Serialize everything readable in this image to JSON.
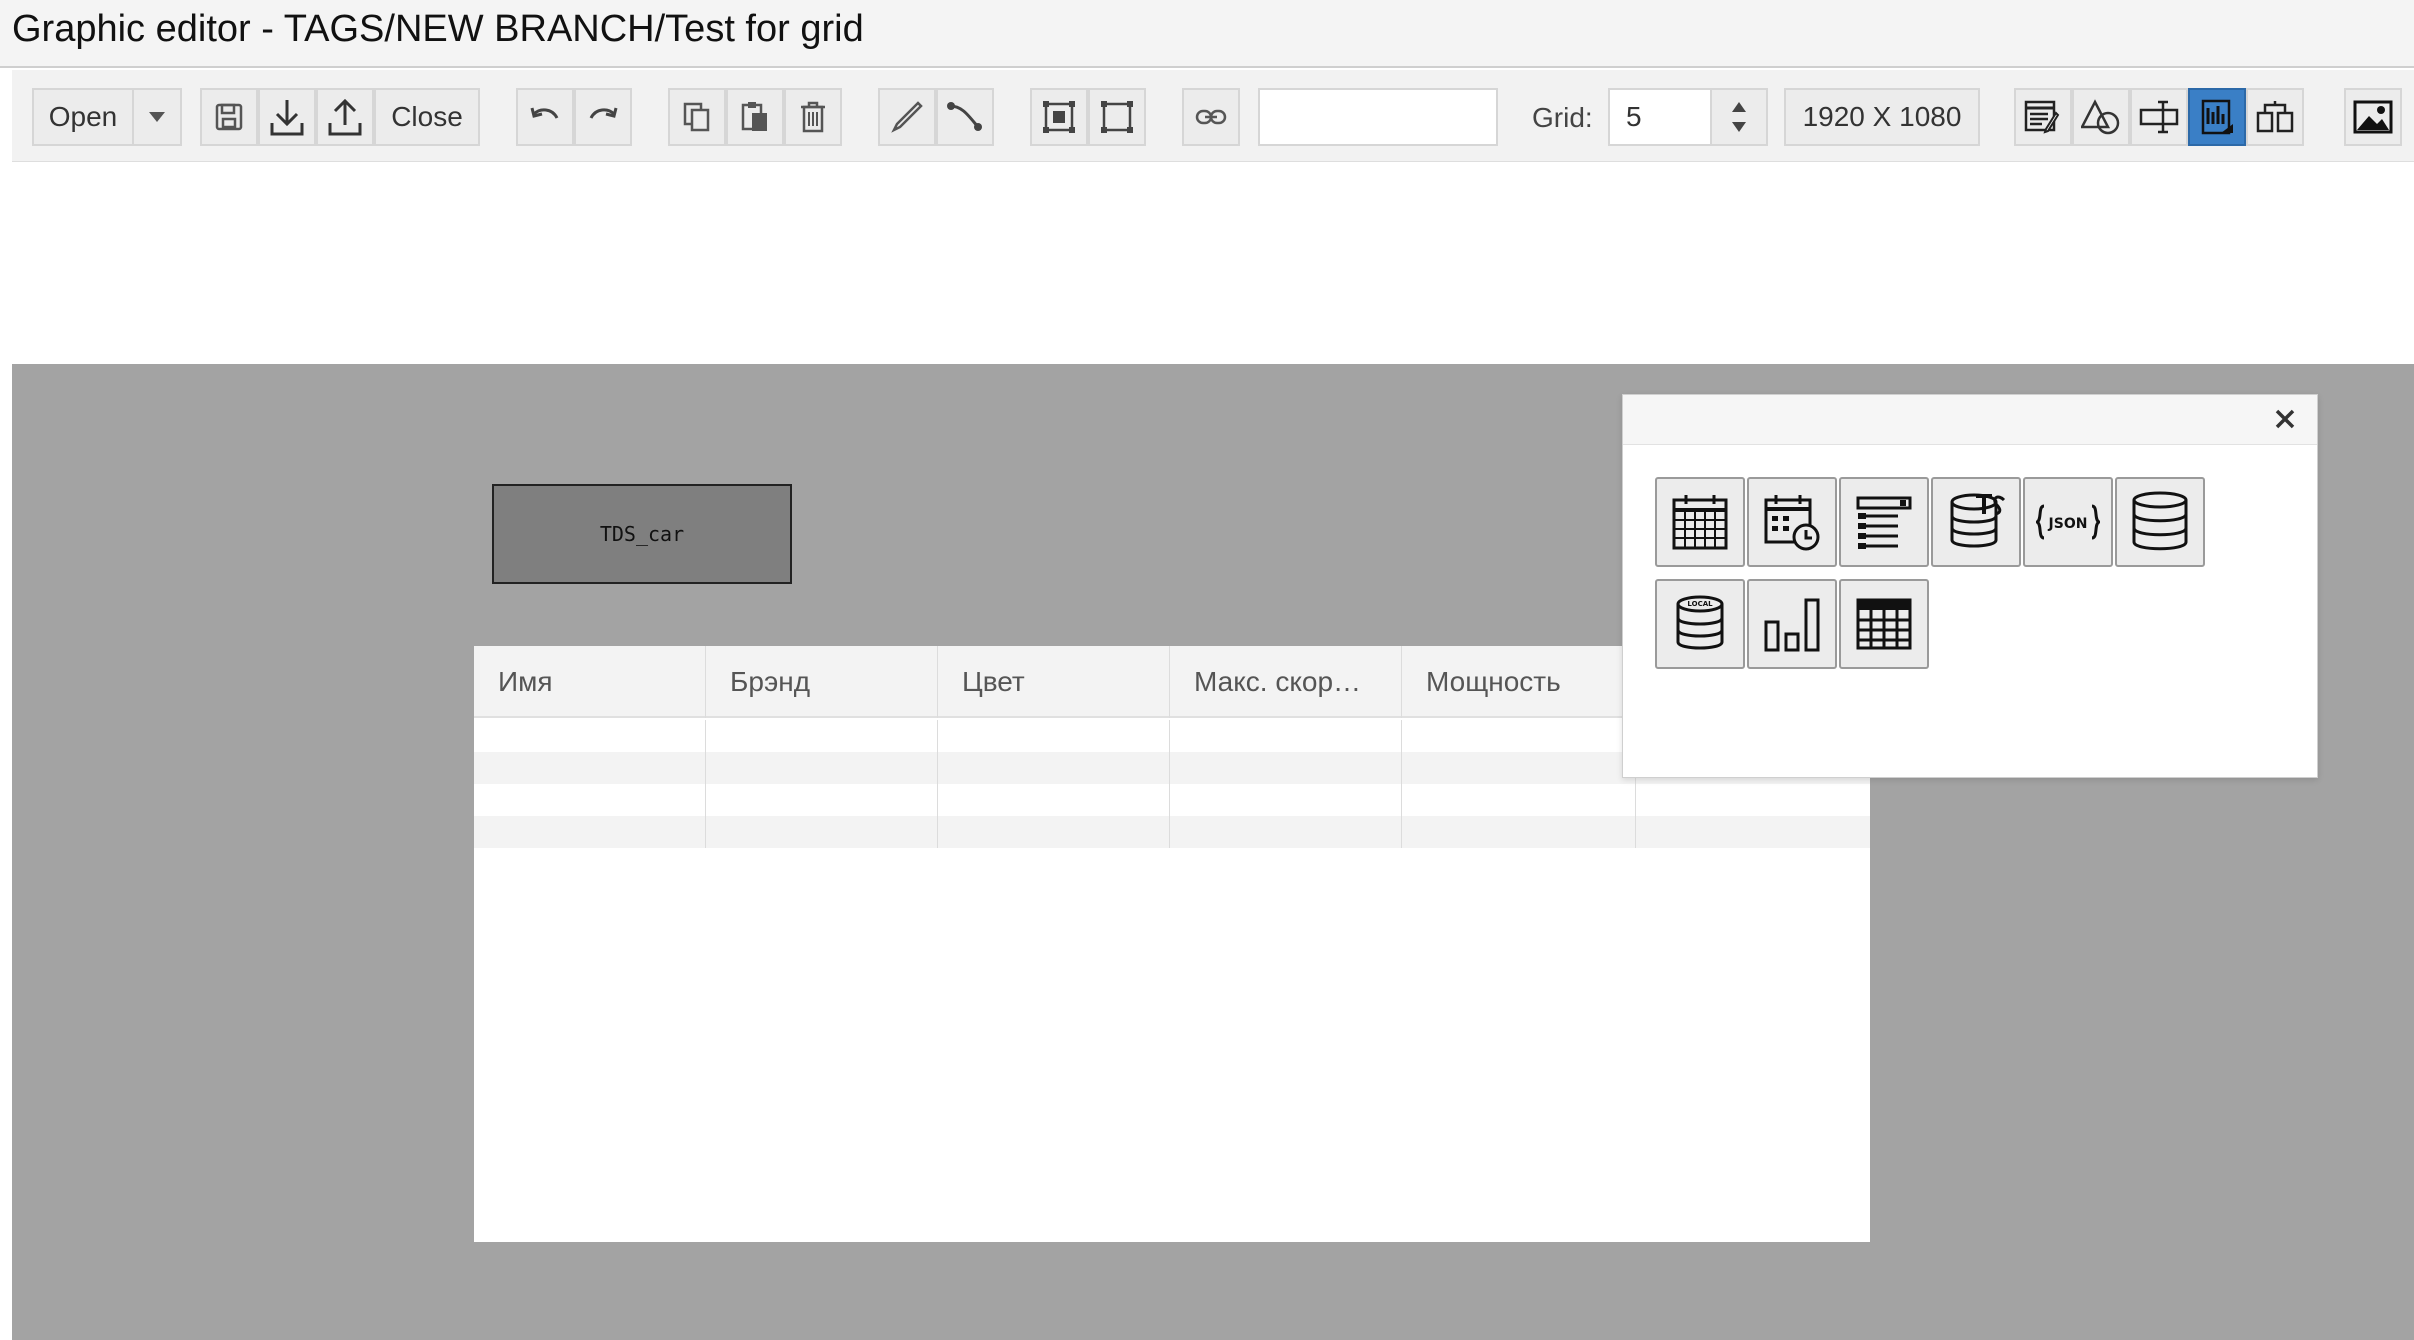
{
  "window": {
    "title": "Graphic editor - TAGS/NEW BRANCH/Test for grid"
  },
  "toolbar": {
    "open_label": "Open",
    "close_label": "Close",
    "link_input_value": "",
    "grid_label": "Grid:",
    "grid_value": "5",
    "resolution_label": "1920 X 1080",
    "active_mode": "grid-mode",
    "active_color": "#3a7fc6",
    "icons": [
      "dropdown-arrow-icon",
      "save-icon",
      "download-icon",
      "upload-icon",
      "undo-icon",
      "redo-icon",
      "copy-icon",
      "paste-icon",
      "trash-icon",
      "pencil-icon",
      "connector-icon",
      "group-icon",
      "ungroup-icon",
      "link-icon",
      "properties-icon",
      "shapes-icon",
      "text-field-icon",
      "grid-mode-icon",
      "components-icon",
      "image-icon"
    ]
  },
  "canvas": {
    "background_color": "#a3a3a3",
    "tag_label": "TDS_car",
    "grid": {
      "columns": [
        "Имя",
        "Брэнд",
        "Цвет",
        "Макс. скор…",
        "Мощность",
        ""
      ],
      "row_count": 4
    }
  },
  "palette": {
    "close_symbol": "✕",
    "items": [
      "calendar-icon",
      "calendar-clock-icon",
      "form-list-icon",
      "ts-database-icon",
      "json-icon",
      "database-icon",
      "local-database-icon",
      "bar-chart-icon",
      "table-icon"
    ]
  }
}
